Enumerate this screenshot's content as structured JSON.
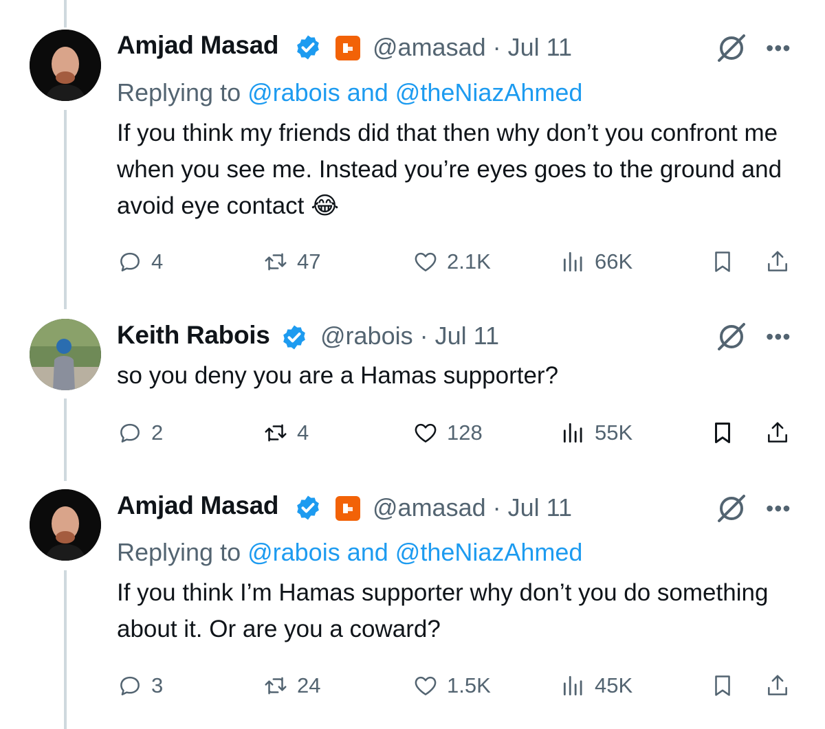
{
  "tweets": [
    {
      "name": "Amjad Masad",
      "handle": "@amasad",
      "date": "Jul 11",
      "replying_prefix": "Replying to ",
      "replying_mentions": "@rabois and @theNiazAhmed",
      "text": "If you think my friends did that then why don’t you confront me when you see me. Instead you’re eyes goes to the ground and avoid eye contact 😂",
      "replies": "4",
      "retweets": "47",
      "likes": "2.1K",
      "views": "66K"
    },
    {
      "name": "Keith Rabois",
      "handle": "@rabois",
      "date": "Jul 11",
      "text": "so you deny you are a Hamas supporter?",
      "replies": "2",
      "retweets": "4",
      "likes": "128",
      "views": "55K"
    },
    {
      "name": "Amjad Masad",
      "handle": "@amasad",
      "date": "Jul 11",
      "replying_prefix": "Replying to ",
      "replying_mentions": "@rabois and @theNiazAhmed",
      "text": "If you think I’m Hamas supporter why don’t you do something about it. Or are you a coward?",
      "replies": "3",
      "retweets": "24",
      "likes": "1.5K",
      "views": "45K"
    }
  ],
  "separator": "·",
  "more_glyph": "•••",
  "colors": {
    "accent": "#1d9bf0",
    "muted": "#536471",
    "replit": "#f26207",
    "thread": "#cfd9de"
  }
}
